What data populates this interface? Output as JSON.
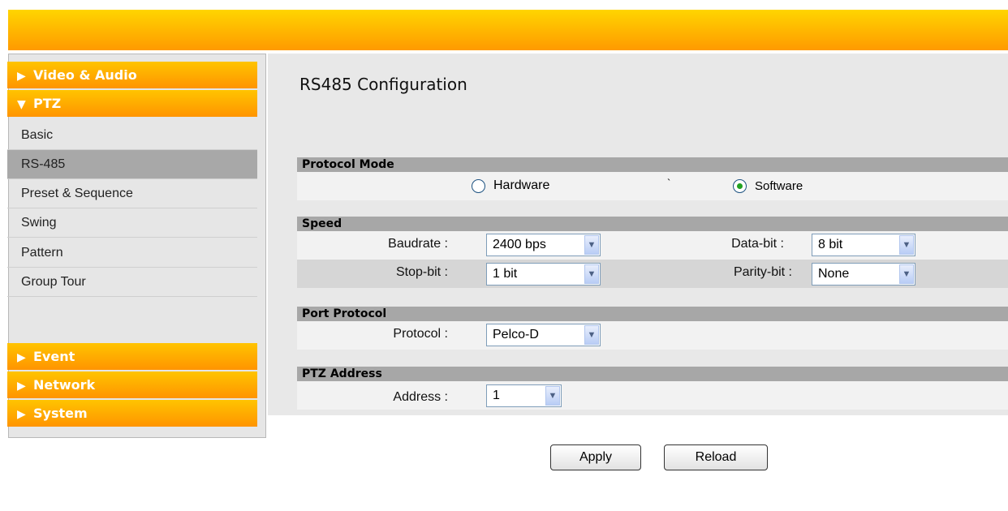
{
  "sidebar": {
    "categories": {
      "video_audio": {
        "arrow": "▶",
        "label": "Video & Audio"
      },
      "ptz": {
        "arrow": "▼",
        "label": "PTZ"
      },
      "event": {
        "arrow": "▶",
        "label": "Event"
      },
      "network": {
        "arrow": "▶",
        "label": "Network"
      },
      "system": {
        "arrow": "▶",
        "label": "System"
      }
    },
    "ptz_items": [
      "Basic",
      "RS-485",
      "Preset & Sequence",
      "Swing",
      "Pattern",
      "Group Tour"
    ],
    "active_item": "RS-485"
  },
  "main": {
    "title": "RS485 Configuration",
    "protocol_mode": {
      "header": "Protocol Mode",
      "hardware_label": "Hardware",
      "software_label": "Software",
      "stray_mark": "`",
      "selected": "Software"
    },
    "speed": {
      "header": "Speed",
      "baudrate_label": "Baudrate :",
      "baudrate_value": "2400 bps",
      "databit_label": "Data-bit :",
      "databit_value": "8 bit",
      "stopbit_label": "Stop-bit :",
      "stopbit_value": "1 bit",
      "paritybit_label": "Parity-bit :",
      "paritybit_value": "None"
    },
    "port_protocol": {
      "header": "Port Protocol",
      "protocol_label": "Protocol :",
      "protocol_value": "Pelco-D"
    },
    "ptz_address": {
      "header": "PTZ Address",
      "address_label": "Address :",
      "address_value": "1"
    },
    "apply_label": "Apply",
    "reload_label": "Reload"
  },
  "icons": {
    "dropdown": "chevron-down-icon",
    "expand": "triangle-right-icon",
    "collapse": "triangle-down-icon"
  },
  "colors": {
    "accent": "#ffb400",
    "section_header": "#a7a7a7",
    "active_item": "#a8a8a8"
  }
}
